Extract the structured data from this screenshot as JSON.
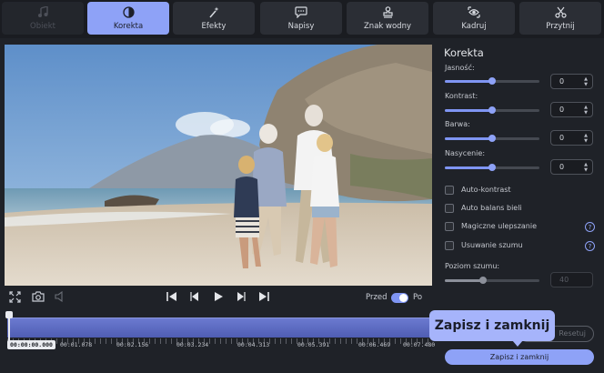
{
  "tabs": [
    {
      "label": "Obiekt",
      "icon": "music-note-icon",
      "state": "disabled"
    },
    {
      "label": "Korekta",
      "icon": "contrast-icon",
      "state": "active"
    },
    {
      "label": "Efekty",
      "icon": "magic-wand-icon",
      "state": "normal"
    },
    {
      "label": "Napisy",
      "icon": "speech-bubble-icon",
      "state": "normal"
    },
    {
      "label": "Znak wodny",
      "icon": "stamp-icon",
      "state": "normal"
    },
    {
      "label": "Kadruj",
      "icon": "crop-icon",
      "state": "normal"
    },
    {
      "label": "Przytnij",
      "icon": "scissors-icon",
      "state": "normal"
    }
  ],
  "player": {
    "toggle_before": "Przed",
    "toggle_after": "Po",
    "toggle_on": true
  },
  "timeline": {
    "current_time": "00:00:00.000",
    "times": [
      "00:01.078",
      "00:02.156",
      "00:03.234",
      "00:04.313",
      "00:05.391",
      "00:06.469",
      "00:07.480"
    ],
    "playhead_fraction": 0.0
  },
  "panel": {
    "title": "Korekta",
    "sliders": [
      {
        "label": "Jasność:",
        "value": "0",
        "fraction": 0.5
      },
      {
        "label": "Kontrast:",
        "value": "0",
        "fraction": 0.5
      },
      {
        "label": "Barwa:",
        "value": "0",
        "fraction": 0.5
      },
      {
        "label": "Nasycenie:",
        "value": "0",
        "fraction": 0.5
      }
    ],
    "checkboxes": [
      {
        "label": "Auto-kontrast",
        "checked": false,
        "help": false
      },
      {
        "label": "Auto balans bieli",
        "checked": false,
        "help": false
      },
      {
        "label": "Magiczne ulepszanie",
        "checked": false,
        "help": true
      },
      {
        "label": "Usuwanie szumu",
        "checked": false,
        "help": true
      }
    ],
    "noise": {
      "label": "Poziom szumu:",
      "value": "40",
      "fraction": 0.4
    },
    "reset_label": "Resetuj",
    "save_label": "Zapisz i zamknij"
  },
  "tooltip": {
    "text": "Zapisz i zamknij"
  },
  "colors": {
    "accent": "#8ea2f7",
    "background": "#1f2228",
    "track": "#5c6bc0"
  }
}
